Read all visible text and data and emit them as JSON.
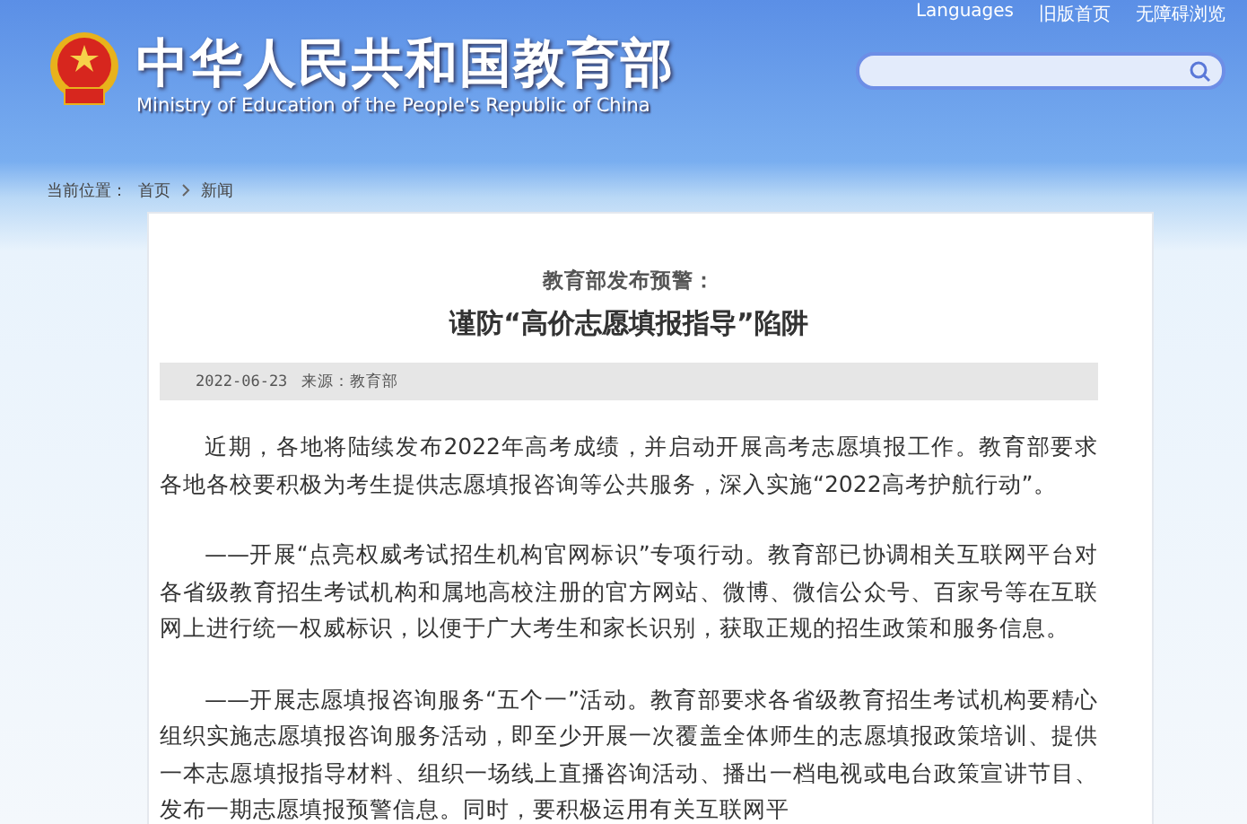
{
  "header": {
    "top_links": [
      "Languages",
      "旧版首页",
      "无障碍浏览"
    ],
    "site_title": "中华人民共和国教育部",
    "site_subtitle": "Ministry of Education of the People's Republic of China"
  },
  "breadcrumb": {
    "label": "当前位置：",
    "items": [
      "首页",
      "新闻"
    ]
  },
  "article": {
    "kicker": "教育部发布预警：",
    "title": "谨防“高价志愿填报指导”陷阱",
    "date": "2022-06-23",
    "source": "来源：教育部",
    "paragraphs": [
      "近期，各地将陆续发布2022年高考成绩，并启动开展高考志愿填报工作。教育部要求各地各校要积极为考生提供志愿填报咨询等公共服务，深入实施“2022高考护航行动”。",
      "——开展“点亮权威考试招生机构官网标识”专项行动。教育部已协调相关互联网平台对各省级教育招生考试机构和属地高校注册的官方网站、微博、微信公众号、百家号等在互联网上进行统一权威标识，以便于广大考生和家长识别，获取正规的招生政策和服务信息。",
      "——开展志愿填报咨询服务“五个一”活动。教育部要求各省级教育招生考试机构要精心组织实施志愿填报咨询服务活动，即至少开展一次覆盖全体师生的志愿填报政策培训、提供一本志愿填报指导材料、组织一场线上直播咨询活动、播出一档电视或电台政策宣讲节目、发布一期志愿填报预警信息。同时，要积极运用有关互联网平"
    ]
  }
}
